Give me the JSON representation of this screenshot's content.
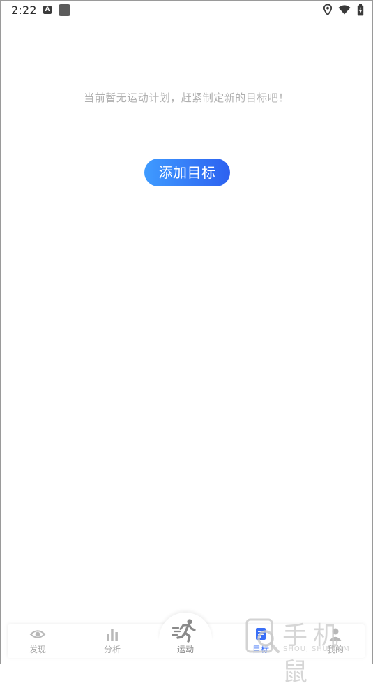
{
  "status_bar": {
    "time": "2:22",
    "notification_letter": "A"
  },
  "empty_state": {
    "message": "当前暂无运动计划，赶紧制定新的目标吧！",
    "add_button_label": "添加目标"
  },
  "bottom_nav": {
    "items": [
      {
        "label": "发现",
        "icon": "eye-icon",
        "active": false
      },
      {
        "label": "分析",
        "icon": "bar-chart-icon",
        "active": false
      },
      {
        "label": "运动",
        "icon": "running-person-icon",
        "active": false
      },
      {
        "label": "目标",
        "icon": "document-icon",
        "active": true
      },
      {
        "label": "我的",
        "icon": "person-icon",
        "active": false
      }
    ]
  },
  "watermark": {
    "text": "手机鼠",
    "subtext": "SHOUJISHU.COM"
  },
  "colors": {
    "accent": "#3a6ff7",
    "button_gradient_start": "#3f9bff",
    "button_gradient_end": "#2d61f0",
    "muted_text": "#b0b0b0"
  }
}
